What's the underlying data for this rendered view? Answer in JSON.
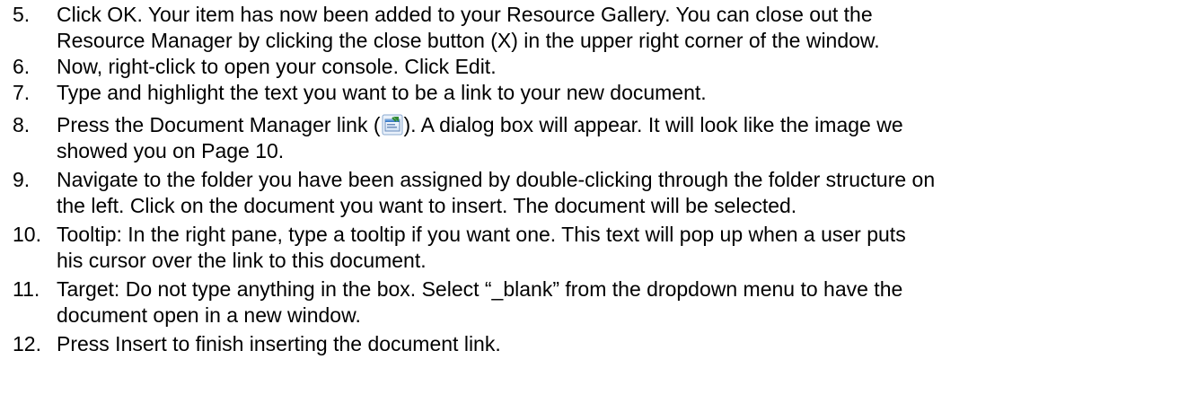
{
  "steps": [
    {
      "num": "5.",
      "lines": [
        "Click OK.  Your item has now been added to your Resource Gallery.  You can close out the",
        "Resource Manager by clicking the close button (X) in the upper right corner of the window."
      ]
    },
    {
      "num": "6.",
      "lines": [
        "Now, right-click to open your console.  Click Edit."
      ]
    },
    {
      "num": "7.",
      "lines": [
        "Type and highlight the text you want to be a link to your new document."
      ]
    },
    {
      "num": "8.",
      "line1_before": "Press the Document Manager link (",
      "line1_after": ").  A dialog box will appear.  It will look like the image we",
      "lines_rest": [
        "showed you on Page 10."
      ],
      "icon": "document-manager-icon"
    },
    {
      "num": "9.",
      "lines": [
        "Navigate to the folder you have been assigned by double-clicking through the folder structure on",
        "the left.  Click on the document you want to insert.  The document will be selected."
      ]
    },
    {
      "num": "10.",
      "lines": [
        "Tooltip: In the right pane, type a tooltip if you want one.  This text will pop up when a user puts",
        "his cursor over the link to this document."
      ]
    },
    {
      "num": "11.",
      "lines": [
        "Target:  Do not type anything in the box.  Select “_blank” from the dropdown menu to have the",
        "document open in a new window."
      ]
    },
    {
      "num": "12.",
      "lines": [
        "Press Insert to finish inserting the document link."
      ]
    }
  ]
}
